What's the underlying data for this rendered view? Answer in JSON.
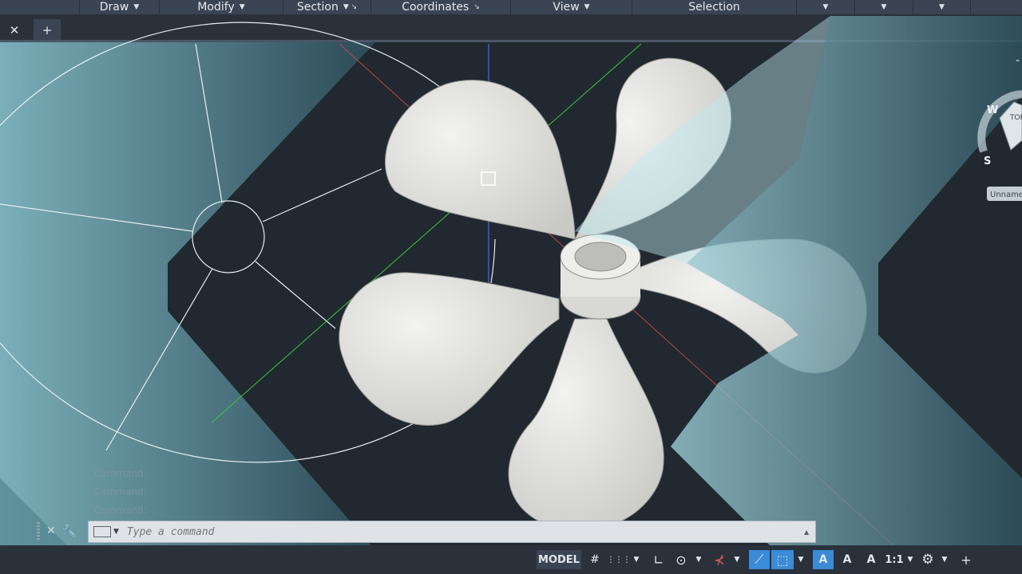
{
  "ribbon": {
    "panels": [
      {
        "label": "Draw",
        "arrow": "▼"
      },
      {
        "label": "Modify",
        "arrow": "▼"
      },
      {
        "label": "Section",
        "arrow": "▼ ↘"
      },
      {
        "label": "Coordinates",
        "arrow": "↘"
      },
      {
        "label": "View",
        "arrow": "▼"
      },
      {
        "label": "Selection",
        "arrow": ""
      },
      {
        "label": "",
        "arrow": "▼"
      },
      {
        "label": "",
        "arrow": "▼"
      },
      {
        "label": "",
        "arrow": "▼"
      }
    ]
  },
  "tabs": {
    "close_glyph": "✕",
    "new_glyph": "+"
  },
  "viewcube": {
    "west": "W",
    "south": "S",
    "top_face": "TOP",
    "wcs_label": "Unnamed"
  },
  "command": {
    "history": [
      "Command:",
      "Command:",
      "Command:"
    ],
    "placeholder": "Type a command",
    "close_glyph": "✕",
    "wrench_glyph": "🔧"
  },
  "statusbar": {
    "model_label": "MODEL",
    "grid_glyph": "#",
    "snap_glyph": "⋮⋮⋮",
    "ortho_glyph": "∟",
    "polar_glyph": "⊙",
    "osnap_glyph": "⊀",
    "lineweight_glyph": "⟋",
    "transparency_glyph": "⬚",
    "annotate_glyph": "A",
    "scale_label": "1:1",
    "gear_glyph": "⚙",
    "plus_glyph": "+"
  },
  "colors": {
    "ribbon_bg": "#3b4453",
    "canvas_bg": "#212830",
    "accent": "#3b8bd6",
    "x_axis": "#d04a4a",
    "y_axis": "#3cc43c",
    "z_axis": "#4a5bd8"
  }
}
